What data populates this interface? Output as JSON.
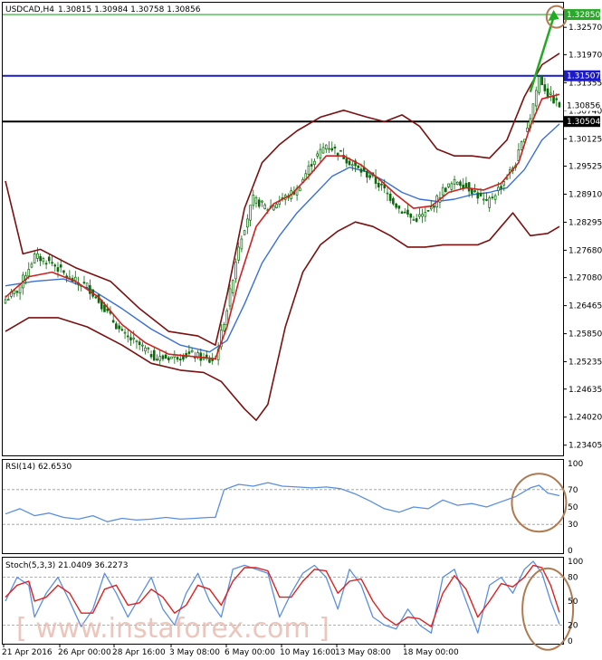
{
  "header": {
    "symbol": "USDCAD,H4",
    "ohlc": "1.30815 1.30984 1.30758 1.30856"
  },
  "colors": {
    "candle": "#0a6a0a",
    "upper_band": "#7b1010",
    "fast_ma": "#d02020",
    "slow_ma": "#3a6fd8",
    "resistance": "#1a1acc",
    "support": "#000000",
    "target": "#2aa82a",
    "arrow": "#22aa22",
    "circle": "#b07a50",
    "rsi_line": "#5a8fe0",
    "stoch_main": "#5a8fe0",
    "stoch_signal": "#e02020"
  },
  "chart_data": [
    {
      "type": "candlestick",
      "title": "USDCAD,H4",
      "ylim": [
        1.2324,
        1.3305
      ],
      "y_ticks": [
        "1.32570",
        "1.31970",
        "1.31355",
        "1.30740",
        "1.30125",
        "1.29525",
        "1.28910",
        "1.28295",
        "1.27680",
        "1.27080",
        "1.26465",
        "1.25850",
        "1.25235",
        "1.24635",
        "1.24020",
        "1.23405"
      ],
      "x_ticks": [
        "21 Apr 2016",
        "26 Apr 00:00",
        "28 Apr 16:00",
        "3 May 08:00",
        "6 May 00:00",
        "10 May 16:00",
        "13 May 08:00",
        "18 May 00:00"
      ],
      "price_labels": {
        "target": "1.32850",
        "resistance": "1.31507",
        "current": "1.30856",
        "support": "1.30504"
      },
      "close_path": [
        [
          0,
          1.266
        ],
        [
          4,
          1.268
        ],
        [
          10,
          1.2755
        ],
        [
          16,
          1.274
        ],
        [
          22,
          1.2705
        ],
        [
          28,
          1.269
        ],
        [
          34,
          1.264
        ],
        [
          40,
          1.2585
        ],
        [
          46,
          1.256
        ],
        [
          52,
          1.253
        ],
        [
          58,
          1.2535
        ],
        [
          64,
          1.254
        ],
        [
          70,
          1.2525
        ],
        [
          72,
          1.253
        ],
        [
          76,
          1.264
        ],
        [
          80,
          1.278
        ],
        [
          85,
          1.288
        ],
        [
          90,
          1.286
        ],
        [
          95,
          1.288
        ],
        [
          100,
          1.29
        ],
        [
          105,
          1.296
        ],
        [
          110,
          1.3
        ],
        [
          115,
          1.298
        ],
        [
          120,
          1.295
        ],
        [
          125,
          1.293
        ],
        [
          130,
          1.29
        ],
        [
          135,
          1.286
        ],
        [
          140,
          1.2835
        ],
        [
          145,
          1.285
        ],
        [
          150,
          1.29
        ],
        [
          155,
          1.292
        ],
        [
          160,
          1.29
        ],
        [
          165,
          1.287
        ],
        [
          170,
          1.291
        ],
        [
          175,
          1.296
        ],
        [
          180,
          1.306
        ],
        [
          183,
          1.3148
        ],
        [
          186,
          1.311
        ],
        [
          190,
          1.3085
        ]
      ],
      "upper_band": [
        [
          0,
          1.292
        ],
        [
          6,
          1.276
        ],
        [
          12,
          1.277
        ],
        [
          24,
          1.273
        ],
        [
          36,
          1.27
        ],
        [
          46,
          1.264
        ],
        [
          56,
          1.259
        ],
        [
          66,
          1.258
        ],
        [
          72,
          1.256
        ],
        [
          76,
          1.267
        ],
        [
          82,
          1.286
        ],
        [
          88,
          1.296
        ],
        [
          94,
          1.3
        ],
        [
          100,
          1.303
        ],
        [
          108,
          1.306
        ],
        [
          116,
          1.3075
        ],
        [
          124,
          1.306
        ],
        [
          130,
          1.305
        ],
        [
          136,
          1.3065
        ],
        [
          142,
          1.304
        ],
        [
          148,
          1.299
        ],
        [
          154,
          1.2975
        ],
        [
          160,
          1.2975
        ],
        [
          166,
          1.297
        ],
        [
          172,
          1.301
        ],
        [
          178,
          1.3105
        ],
        [
          184,
          1.3175
        ],
        [
          190,
          1.32
        ]
      ],
      "lower_band": [
        [
          0,
          1.259
        ],
        [
          8,
          1.262
        ],
        [
          18,
          1.262
        ],
        [
          28,
          1.26
        ],
        [
          40,
          1.256
        ],
        [
          50,
          1.252
        ],
        [
          60,
          1.2505
        ],
        [
          68,
          1.25
        ],
        [
          74,
          1.248
        ],
        [
          78,
          1.245
        ],
        [
          82,
          1.242
        ],
        [
          86,
          1.2395
        ],
        [
          90,
          1.243
        ],
        [
          96,
          1.26
        ],
        [
          102,
          1.272
        ],
        [
          108,
          1.278
        ],
        [
          114,
          1.281
        ],
        [
          120,
          1.283
        ],
        [
          126,
          1.282
        ],
        [
          132,
          1.28
        ],
        [
          138,
          1.2775
        ],
        [
          144,
          1.2775
        ],
        [
          150,
          1.278
        ],
        [
          156,
          1.278
        ],
        [
          162,
          1.278
        ],
        [
          166,
          1.279
        ],
        [
          170,
          1.282
        ],
        [
          174,
          1.285
        ],
        [
          180,
          1.28
        ],
        [
          186,
          1.2805
        ],
        [
          190,
          1.282
        ]
      ],
      "fast_ma": [
        [
          0,
          1.2665
        ],
        [
          8,
          1.271
        ],
        [
          16,
          1.272
        ],
        [
          24,
          1.27
        ],
        [
          32,
          1.2665
        ],
        [
          40,
          1.2605
        ],
        [
          48,
          1.2565
        ],
        [
          56,
          1.254
        ],
        [
          64,
          1.2535
        ],
        [
          72,
          1.253
        ],
        [
          76,
          1.26
        ],
        [
          80,
          1.27
        ],
        [
          86,
          1.282
        ],
        [
          92,
          1.287
        ],
        [
          98,
          1.289
        ],
        [
          104,
          1.293
        ],
        [
          110,
          1.2975
        ],
        [
          116,
          1.2975
        ],
        [
          122,
          1.2955
        ],
        [
          128,
          1.2925
        ],
        [
          134,
          1.289
        ],
        [
          140,
          1.286
        ],
        [
          146,
          1.2865
        ],
        [
          152,
          1.2895
        ],
        [
          158,
          1.2905
        ],
        [
          164,
          1.29
        ],
        [
          170,
          1.2915
        ],
        [
          176,
          1.296
        ],
        [
          180,
          1.304
        ],
        [
          184,
          1.31
        ],
        [
          190,
          1.311
        ]
      ],
      "slow_ma": [
        [
          0,
          1.269
        ],
        [
          10,
          1.27
        ],
        [
          20,
          1.2705
        ],
        [
          30,
          1.268
        ],
        [
          40,
          1.264
        ],
        [
          50,
          1.2595
        ],
        [
          60,
          1.256
        ],
        [
          70,
          1.2545
        ],
        [
          76,
          1.257
        ],
        [
          82,
          1.265
        ],
        [
          88,
          1.274
        ],
        [
          94,
          1.28
        ],
        [
          100,
          1.285
        ],
        [
          106,
          1.289
        ],
        [
          112,
          1.293
        ],
        [
          118,
          1.295
        ],
        [
          124,
          1.294
        ],
        [
          130,
          1.292
        ],
        [
          136,
          1.2895
        ],
        [
          142,
          1.288
        ],
        [
          148,
          1.2875
        ],
        [
          154,
          1.288
        ],
        [
          160,
          1.289
        ],
        [
          166,
          1.2895
        ],
        [
          172,
          1.2905
        ],
        [
          178,
          1.2945
        ],
        [
          184,
          1.301
        ],
        [
          190,
          1.3045
        ]
      ],
      "arrow": {
        "from": [
          180,
          1.3115
        ],
        "to": [
          188,
          1.3295
        ]
      },
      "target_circle": [
        189,
        1.328
      ]
    },
    {
      "type": "line",
      "title": "RSI(14) 62.6530",
      "ylim": [
        0,
        100
      ],
      "y_ticks": [
        "100",
        "70",
        "50",
        "30",
        "0"
      ],
      "levels": [
        70,
        30
      ],
      "values": [
        [
          0,
          42
        ],
        [
          5,
          48
        ],
        [
          10,
          40
        ],
        [
          15,
          43
        ],
        [
          20,
          38
        ],
        [
          25,
          36
        ],
        [
          30,
          40
        ],
        [
          35,
          33
        ],
        [
          40,
          37
        ],
        [
          45,
          35
        ],
        [
          50,
          36
        ],
        [
          55,
          38
        ],
        [
          60,
          36
        ],
        [
          65,
          37
        ],
        [
          70,
          38
        ],
        [
          72,
          38
        ],
        [
          75,
          70
        ],
        [
          80,
          76
        ],
        [
          85,
          74
        ],
        [
          90,
          78
        ],
        [
          95,
          74
        ],
        [
          100,
          73
        ],
        [
          105,
          72
        ],
        [
          110,
          73
        ],
        [
          115,
          71
        ],
        [
          120,
          65
        ],
        [
          125,
          57
        ],
        [
          130,
          48
        ],
        [
          135,
          44
        ],
        [
          140,
          50
        ],
        [
          145,
          48
        ],
        [
          150,
          58
        ],
        [
          155,
          52
        ],
        [
          160,
          54
        ],
        [
          165,
          50
        ],
        [
          170,
          56
        ],
        [
          175,
          62
        ],
        [
          180,
          72
        ],
        [
          183,
          75
        ],
        [
          186,
          66
        ],
        [
          190,
          63
        ]
      ]
    },
    {
      "type": "line",
      "title": "Stoch(5,3,3) 21.0409 36.2273",
      "ylim": [
        0,
        100
      ],
      "y_ticks": [
        "100",
        "80",
        "50",
        "20",
        "0"
      ],
      "levels": [
        80,
        20
      ],
      "series": [
        {
          "values": [
            [
              0,
              50
            ],
            [
              4,
              80
            ],
            [
              8,
              70
            ],
            [
              10,
              30
            ],
            [
              14,
              60
            ],
            [
              18,
              80
            ],
            [
              22,
              50
            ],
            [
              26,
              18
            ],
            [
              30,
              40
            ],
            [
              34,
              85
            ],
            [
              38,
              60
            ],
            [
              42,
              30
            ],
            [
              46,
              55
            ],
            [
              50,
              80
            ],
            [
              54,
              40
            ],
            [
              58,
              20
            ],
            [
              62,
              60
            ],
            [
              66,
              85
            ],
            [
              70,
              50
            ],
            [
              74,
              30
            ],
            [
              78,
              90
            ],
            [
              82,
              95
            ],
            [
              86,
              90
            ],
            [
              90,
              85
            ],
            [
              94,
              30
            ],
            [
              98,
              60
            ],
            [
              102,
              85
            ],
            [
              106,
              95
            ],
            [
              110,
              80
            ],
            [
              114,
              40
            ],
            [
              118,
              90
            ],
            [
              122,
              70
            ],
            [
              126,
              30
            ],
            [
              130,
              20
            ],
            [
              134,
              15
            ],
            [
              138,
              40
            ],
            [
              142,
              20
            ],
            [
              146,
              10
            ],
            [
              150,
              80
            ],
            [
              154,
              90
            ],
            [
              158,
              50
            ],
            [
              162,
              10
            ],
            [
              166,
              70
            ],
            [
              170,
              80
            ],
            [
              174,
              60
            ],
            [
              178,
              90
            ],
            [
              181,
              100
            ],
            [
              184,
              85
            ],
            [
              187,
              50
            ],
            [
              190,
              21
            ]
          ]
        },
        {
          "values": [
            [
              0,
              55
            ],
            [
              4,
              70
            ],
            [
              8,
              75
            ],
            [
              10,
              50
            ],
            [
              14,
              55
            ],
            [
              18,
              70
            ],
            [
              22,
              60
            ],
            [
              26,
              35
            ],
            [
              30,
              35
            ],
            [
              34,
              65
            ],
            [
              38,
              70
            ],
            [
              42,
              45
            ],
            [
              46,
              48
            ],
            [
              50,
              65
            ],
            [
              54,
              55
            ],
            [
              58,
              35
            ],
            [
              62,
              45
            ],
            [
              66,
              70
            ],
            [
              70,
              65
            ],
            [
              74,
              45
            ],
            [
              78,
              75
            ],
            [
              82,
              92
            ],
            [
              86,
              92
            ],
            [
              90,
              88
            ],
            [
              94,
              55
            ],
            [
              98,
              55
            ],
            [
              102,
              75
            ],
            [
              106,
              90
            ],
            [
              110,
              88
            ],
            [
              114,
              60
            ],
            [
              118,
              75
            ],
            [
              122,
              78
            ],
            [
              126,
              50
            ],
            [
              130,
              30
            ],
            [
              134,
              20
            ],
            [
              138,
              30
            ],
            [
              142,
              28
            ],
            [
              146,
              18
            ],
            [
              150,
              60
            ],
            [
              154,
              82
            ],
            [
              158,
              65
            ],
            [
              162,
              30
            ],
            [
              166,
              50
            ],
            [
              170,
              72
            ],
            [
              174,
              68
            ],
            [
              178,
              80
            ],
            [
              181,
              95
            ],
            [
              184,
              92
            ],
            [
              187,
              70
            ],
            [
              190,
              36
            ]
          ]
        }
      ],
      "rsi_circle": [
        183,
        55
      ],
      "stoch_circle": [
        186,
        40
      ]
    }
  ],
  "watermark": "[   www.instaforex.com   ]"
}
